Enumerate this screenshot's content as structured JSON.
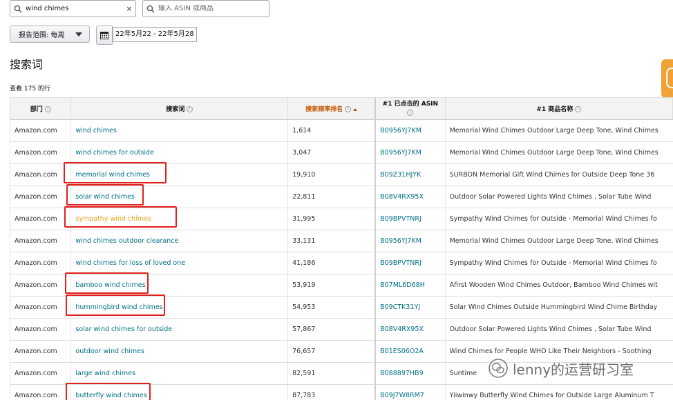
{
  "search": {
    "value": "wind chimes",
    "clear": "×"
  },
  "asin_search": {
    "placeholder": "输入 ASIN 或商品"
  },
  "report_range": {
    "label": "报告范围: 每周"
  },
  "date_range": {
    "value": "22年5月22 - 22年5月28"
  },
  "page_title": "搜索词",
  "row_count": "查看 175 的行",
  "columns": {
    "dept": "部门",
    "term": "搜索词",
    "rank": "搜索频率排名",
    "asin_line1": "#1 已点击的 ASIN",
    "product": "#1 商品名称"
  },
  "rows": [
    {
      "dept": "Amazon.com",
      "term": "wind chimes",
      "rank": "1,614",
      "asin": "B0956YJ7KM",
      "product": "Memorial Wind Chimes Outdoor Large Deep Tone, Wind Chimes"
    },
    {
      "dept": "Amazon.com",
      "term": "wind chimes for outside",
      "rank": "3,047",
      "asin": "B0956YJ7KM",
      "product": "Memorial Wind Chimes Outdoor Large Deep Tone, Wind Chimes"
    },
    {
      "dept": "Amazon.com",
      "term": "memorial wind chimes",
      "rank": "19,910",
      "asin": "B09Z31HJYK",
      "product": "SURBON Memorial Gift Wind Chimes for Outside Deep Tone 36"
    },
    {
      "dept": "Amazon.com",
      "term": "solar wind chimes",
      "rank": "22,811",
      "asin": "B08V4RX95X",
      "product": "Outdoor Solar Powered Lights Wind Chimes , Solar Tube Wind"
    },
    {
      "dept": "Amazon.com",
      "term": "sympathy wind chimes",
      "rank": "31,995",
      "asin": "B09BPVTNRJ",
      "product": "Sympathy Wind Chimes for Outside - Memorial Wind Chimes fo"
    },
    {
      "dept": "Amazon.com",
      "term": "wind chimes outdoor clearance",
      "rank": "33,131",
      "asin": "B0956YJ7KM",
      "product": "Memorial Wind Chimes Outdoor Large Deep Tone, Wind Chimes"
    },
    {
      "dept": "Amazon.com",
      "term": "wind chimes for loss of loved one",
      "rank": "41,186",
      "asin": "B09BPVTNRJ",
      "product": "Sympathy Wind Chimes for Outside - Memorial Wind Chimes fo"
    },
    {
      "dept": "Amazon.com",
      "term": "bamboo wind chimes",
      "rank": "53,919",
      "asin": "B07ML6D68H",
      "product": "Afirst Wooden Wind Chimes Outdoor, Bamboo Wind Chimes wit"
    },
    {
      "dept": "Amazon.com",
      "term": "hummingbird wind chimes",
      "rank": "54,953",
      "asin": "B09CTK31YJ",
      "product": "Solar Wind Chimes Outside Hummingbird Wind Chime Birthday"
    },
    {
      "dept": "Amazon.com",
      "term": "solar wind chimes for outside",
      "rank": "57,867",
      "asin": "B08V4RX95X",
      "product": "Outdoor Solar Powered Lights Wind Chimes , Solar Tube Wind"
    },
    {
      "dept": "Amazon.com",
      "term": "outdoor wind chimes",
      "rank": "76,657",
      "asin": "B01ES06O2A",
      "product": "Wind Chimes for People WHO Like Their Neighbors - Soothing"
    },
    {
      "dept": "Amazon.com",
      "term": "large wind chimes",
      "rank": "82,591",
      "asin": "B088897HB9",
      "product": "Suntime"
    },
    {
      "dept": "Amazon.com",
      "term": "butterfly wind chimes",
      "rank": "87,783",
      "asin": "B09J7W8RM7",
      "product": "Yiiwinwy Butterfly Wind Chimes for Outside Large Aluminum T"
    }
  ],
  "watermark": "lenny的运营研习室",
  "colors": {
    "link": "#007185",
    "highlight": "#f0a21e",
    "sort_header": "#c45500",
    "annotation_box": "#e0201c",
    "side_tab": "#f0a334"
  }
}
